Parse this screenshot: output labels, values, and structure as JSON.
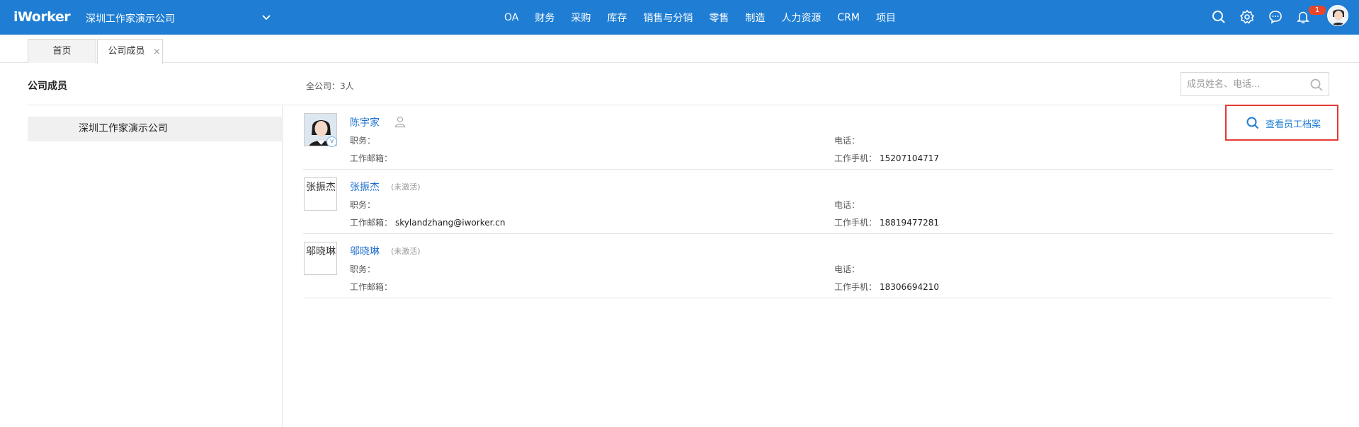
{
  "app": {
    "logo": "iWorker",
    "company": "深圳工作家演示公司"
  },
  "nav": [
    "OA",
    "财务",
    "采购",
    "库存",
    "销售与分销",
    "零售",
    "制造",
    "人力资源",
    "CRM",
    "项目"
  ],
  "topbar": {
    "notification_count": "1",
    "icons": [
      "search-icon",
      "gear-icon",
      "chat-icon",
      "bell-icon"
    ]
  },
  "tabs": [
    {
      "label": "首页"
    },
    {
      "label": "公司成员",
      "close": "×"
    }
  ],
  "page": {
    "title": "公司成员",
    "count_text": "全公司：3人",
    "search_placeholder": "成员姓名、电话..."
  },
  "org_tree": {
    "selected": "深圳工作家演示公司"
  },
  "labels": {
    "position": "职务：",
    "phone": "电话：",
    "email": "工作邮箱：",
    "mobile": "工作手机：",
    "view_profile": "查看员工档案"
  },
  "members": [
    {
      "name": "陈宇家",
      "status": "",
      "avatar_alt": "",
      "verified_badge": "v",
      "position": "",
      "phone": "",
      "email": "",
      "mobile": "15207104717"
    },
    {
      "name": "张振杰",
      "status": "(未激活)",
      "avatar_alt": "张振杰",
      "position": "",
      "phone": "",
      "email": "skylandzhang@iworker.cn",
      "mobile": "18819477281"
    },
    {
      "name": "邬晓琳",
      "status": "(未激活)",
      "avatar_alt": "邬晓琳",
      "position": "",
      "phone": "",
      "email": "",
      "mobile": "18306694210"
    }
  ],
  "colors": {
    "topbar": "#1f7ed4",
    "link": "#1f6fcf",
    "highlight_box": "#e53935",
    "badge": "#e8462b"
  }
}
